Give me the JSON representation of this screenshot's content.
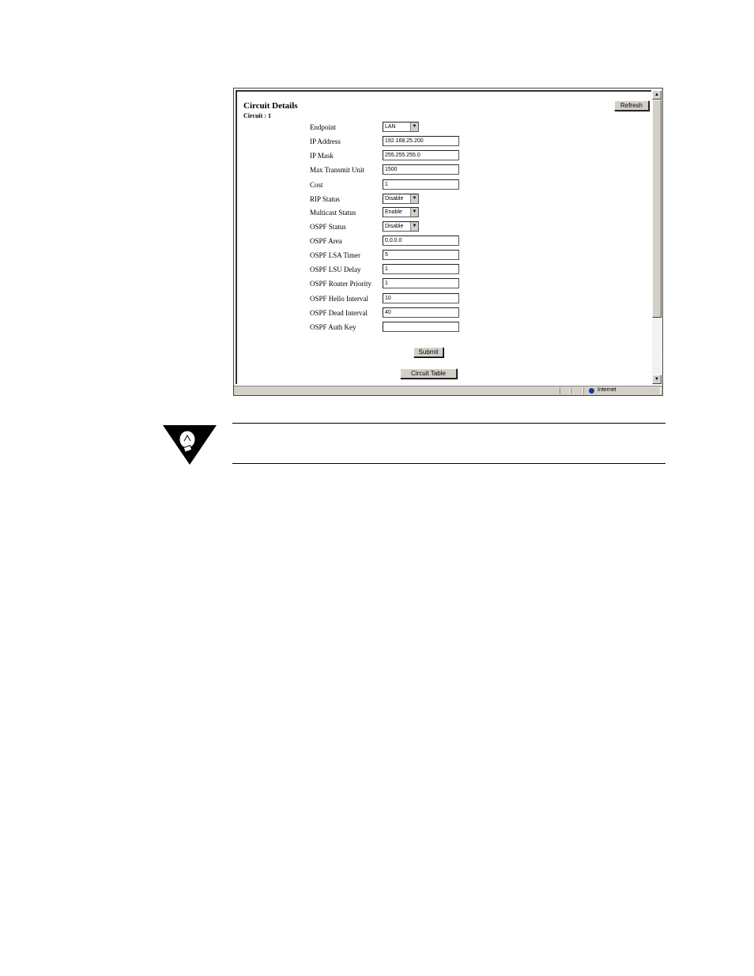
{
  "page": {
    "title": "Circuit Details",
    "subtitle": "Circuit : 1",
    "refresh_label": "Refresh",
    "submit_label": "Submit",
    "circuit_table_label": "Circuit Table"
  },
  "form": {
    "fields": [
      {
        "label": "Endpoint",
        "type": "select",
        "value": "LAN"
      },
      {
        "label": "IP Address",
        "type": "text",
        "value": "192.168.25.200"
      },
      {
        "label": "IP Mask",
        "type": "text",
        "value": "255.255.255.0"
      },
      {
        "label": "Max Transmit Unit",
        "type": "text",
        "value": "1500"
      },
      {
        "label": "Cost",
        "type": "text",
        "value": "1"
      },
      {
        "label": "RIP Status",
        "type": "select",
        "value": "Disable"
      },
      {
        "label": "Multicast Status",
        "type": "select",
        "value": "Enable"
      },
      {
        "label": "OSPF Status",
        "type": "select",
        "value": "Disable"
      },
      {
        "label": "OSPF Area",
        "type": "text",
        "value": "0.0.0.0"
      },
      {
        "label": "OSPF LSA Timer",
        "type": "text",
        "value": "5"
      },
      {
        "label": "OSPF LSU Delay",
        "type": "text",
        "value": "1"
      },
      {
        "label": "OSPF Router Priority",
        "type": "text",
        "value": "1"
      },
      {
        "label": "OSPF Hello Interval",
        "type": "text",
        "value": "10"
      },
      {
        "label": "OSPF Dead Interval",
        "type": "text",
        "value": "40"
      },
      {
        "label": "OSPF Auth Key",
        "type": "text",
        "value": ""
      }
    ]
  },
  "statusbar": {
    "zone_label": "Internet",
    "zone_icon": "globe-icon"
  },
  "note": {
    "icon": "lightbulb-icon"
  },
  "colors": {
    "button_face": "#d4d0c8",
    "zone_icon": "#1a3aa0"
  }
}
